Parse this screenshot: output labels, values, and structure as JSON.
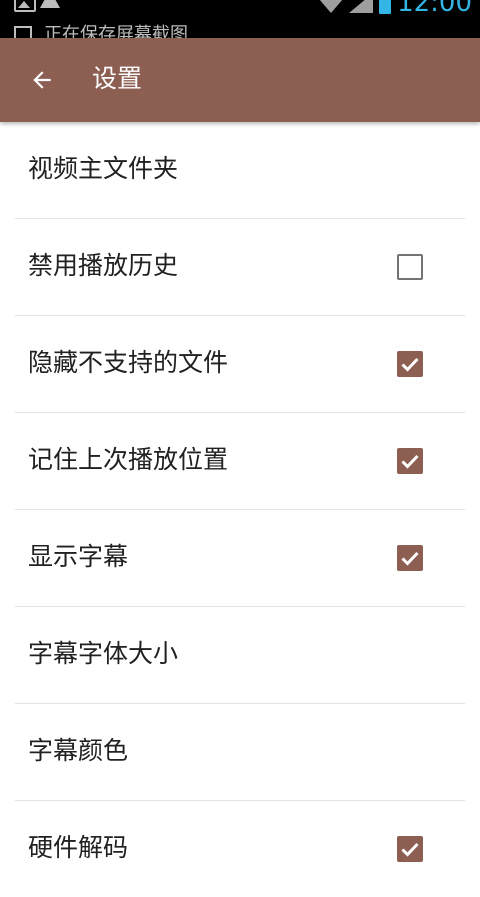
{
  "status_bar": {
    "notification_text": "正在保存屏幕截图",
    "time": "12:00"
  },
  "toolbar": {
    "title": "设置",
    "background_color": "#8d5e52"
  },
  "settings": [
    {
      "label": "视频主文件夹",
      "checkbox": null
    },
    {
      "label": "禁用播放历史",
      "checkbox": false
    },
    {
      "label": "隐藏不支持的文件",
      "checkbox": true
    },
    {
      "label": "记住上次播放位置",
      "checkbox": true
    },
    {
      "label": "显示字幕",
      "checkbox": true
    },
    {
      "label": "字幕字体大小",
      "checkbox": null
    },
    {
      "label": "字幕颜色",
      "checkbox": null
    },
    {
      "label": "硬件解码",
      "checkbox": true
    }
  ],
  "colors": {
    "accent": "#8d5e52",
    "status_accent": "#33b5e5"
  }
}
